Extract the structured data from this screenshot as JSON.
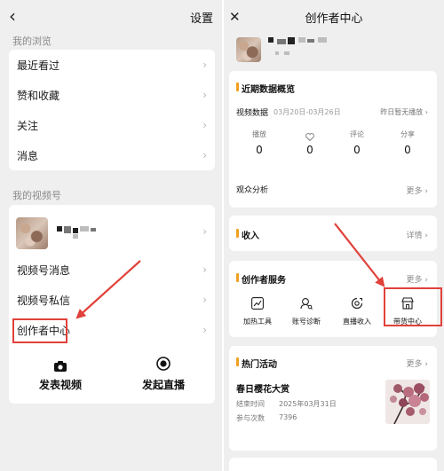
{
  "left": {
    "title": "设置",
    "back_icon": "‹",
    "browse_label": "我的浏览",
    "browse_items": [
      {
        "label": "最近看过"
      },
      {
        "label": "赞和收藏"
      },
      {
        "label": "关注"
      },
      {
        "label": "消息"
      }
    ],
    "channel_label": "我的视频号",
    "channel_items": [
      {
        "label": "视频号消息"
      },
      {
        "label": "视频号私信"
      },
      {
        "label": "创作者中心"
      }
    ],
    "actions": [
      {
        "label": "发表视频",
        "icon": "camera-icon"
      },
      {
        "label": "发起直播",
        "icon": "live-icon"
      }
    ]
  },
  "right": {
    "title": "创作者中心",
    "close_icon": "✕",
    "overview": {
      "title": "近期数据概览",
      "data_label": "视频数据",
      "date_range": "03月20日-03月26日",
      "status": "昨日暂无播放",
      "stats": [
        {
          "label": "播放",
          "value": "0"
        },
        {
          "label": "",
          "icon": "heart-icon",
          "value": "0"
        },
        {
          "label": "评论",
          "value": "0"
        },
        {
          "label": "分享",
          "value": "0"
        }
      ],
      "audience": "观众分析",
      "audience_more": "更多"
    },
    "income": {
      "title": "收入",
      "more": "详情"
    },
    "services": {
      "title": "创作者服务",
      "more": "更多",
      "items": [
        {
          "label": "加热工具",
          "icon": "trend-icon"
        },
        {
          "label": "账号诊断",
          "icon": "diagnosis-icon"
        },
        {
          "label": "直播收入",
          "icon": "income-icon"
        },
        {
          "label": "带货中心",
          "icon": "shop-icon"
        }
      ]
    },
    "activities": {
      "title": "热门活动",
      "more": "更多",
      "name": "春日樱花大赏",
      "end_label": "结束时间",
      "end_value": "2025年03月31日",
      "count_label": "参与次数",
      "count_value": "7396"
    }
  },
  "colors": {
    "highlight": "#e0413a",
    "accent": "#f0a020",
    "background": "#efefef"
  }
}
